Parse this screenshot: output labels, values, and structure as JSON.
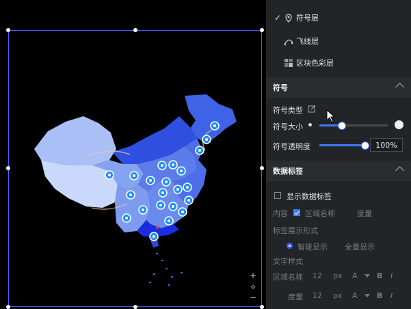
{
  "layers": [
    {
      "label": "符号层",
      "checked": true,
      "icon": "map-pin-icon"
    },
    {
      "label": "飞线层",
      "checked": false,
      "icon": "flyline-icon"
    },
    {
      "label": "区块色彩层",
      "checked": false,
      "icon": "block-color-icon"
    }
  ],
  "symbol_section": {
    "title": "符号",
    "type_label": "符号类型",
    "size_label": "符号大小",
    "size_value": 0.32,
    "opacity_label": "符号透明度",
    "opacity_value": "100%",
    "opacity_fraction": 1.0
  },
  "data_label_section": {
    "title": "数据标签",
    "show_label": "显示数据标签",
    "content_label": "内容",
    "region_name": "区域名称",
    "measure": "度量",
    "display_form_label": "标签展示形式",
    "smart_display": "智能显示",
    "full_display": "全量显示",
    "text_style_label": "文字样式",
    "rows": [
      {
        "name": "区域名称",
        "size": "12",
        "unit": "px",
        "font": "A",
        "bold": "B",
        "italic": "I"
      },
      {
        "name": "度量",
        "size": "12",
        "unit": "px",
        "font": "A",
        "bold": "B",
        "italic": "I"
      }
    ]
  },
  "zoom": {
    "plus": "+",
    "reset": "⟡",
    "minus": "−"
  },
  "colors": {
    "accent": "#3b7bff",
    "panel": "#232427",
    "selection": "#4a5cff"
  }
}
